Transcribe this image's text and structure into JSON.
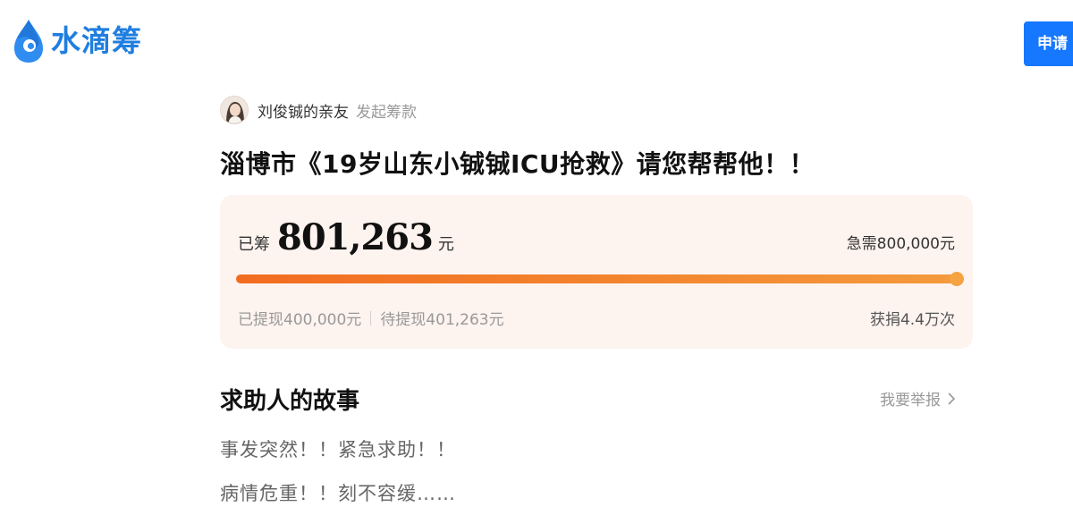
{
  "header": {
    "brand_name": "水滴筹",
    "apply_label": "申请",
    "brand_color": "#1f7ee0",
    "button_color": "#1677ff",
    "logo_icon": "water-drop-icon"
  },
  "initiator": {
    "name": "刘俊铖的亲友",
    "action": "发起筹款",
    "avatar_icon": "user-avatar"
  },
  "campaign": {
    "title": "淄博市《19岁山东小铖铖ICU抢救》请您帮帮他！！"
  },
  "fund": {
    "raised_label": "已筹",
    "raised_amount": "801,263",
    "raised_unit": "元",
    "target_text": "急需800,000元",
    "progress_fraction": 1.0,
    "progress_color_start": "#f26c1f",
    "progress_color_end": "#f49a3c",
    "withdrawn_text": "已提现400,000元",
    "pending_text": "待提现401,263元",
    "donations_text": "获捐4.4万次"
  },
  "story": {
    "heading": "求助人的故事",
    "report_label": "我要举报",
    "report_icon": "chevron-right-icon",
    "lines": [
      "事发突然！！紧急求助！！",
      "病情危重！！刻不容缓……"
    ]
  }
}
